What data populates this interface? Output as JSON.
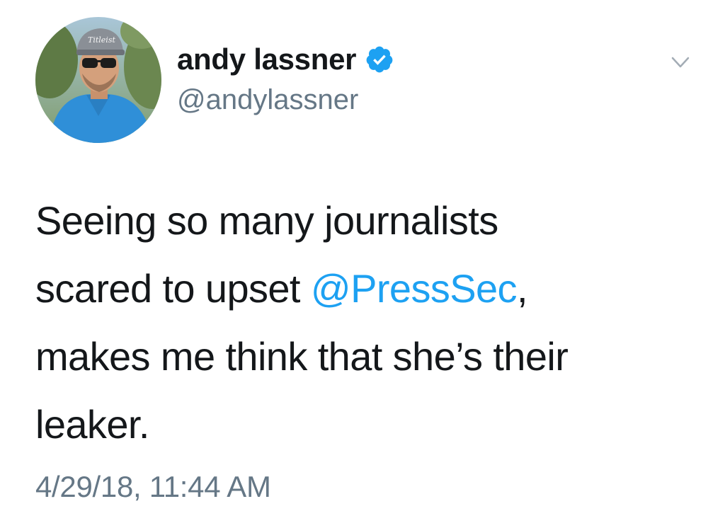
{
  "tweet": {
    "author": {
      "display_name": "andy lassner",
      "handle": "@andylassner",
      "verified": true,
      "verified_icon": "verified-badge-icon",
      "avatar_description": "avatar"
    },
    "body": {
      "line1": "Seeing so many journalists",
      "line2_before": "scared to upset ",
      "line2_mention": "@PressSec",
      "line2_after": ",",
      "line3": "makes me think that she’s their",
      "line4": "leaker."
    },
    "timestamp": "4/29/18, 11:44 AM",
    "menu_icon": "chevron-down-icon"
  },
  "colors": {
    "text": "#14171a",
    "secondary": "#657786",
    "accent": "#1da1f2",
    "background": "#ffffff"
  }
}
